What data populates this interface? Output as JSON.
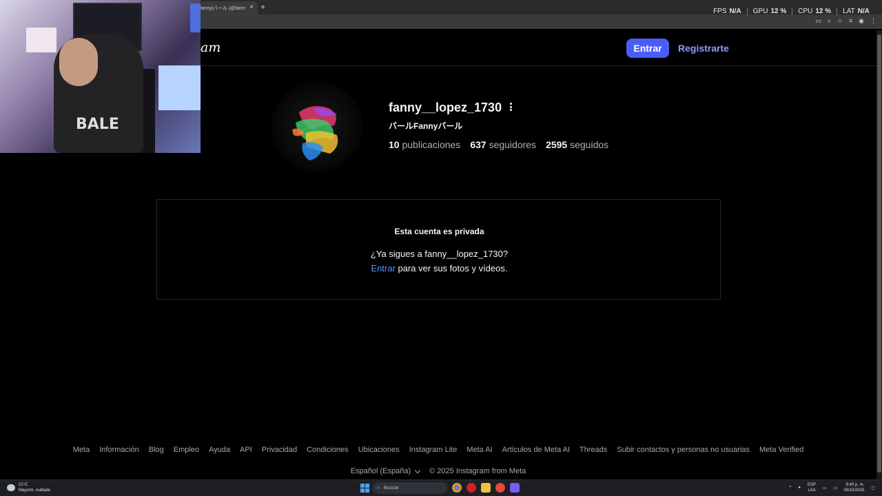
{
  "browser": {
    "tab_title": "fanny|バール (@fanny__lopez_1730)",
    "tab_close": "×",
    "new_tab": "+"
  },
  "overlay_stats": [
    {
      "label": "FPS",
      "value": "N/A"
    },
    {
      "label": "GPU",
      "value": "12 %"
    },
    {
      "label": "CPU",
      "value": "12 %"
    },
    {
      "label": "LAT",
      "value": "N/A"
    }
  ],
  "webcam": {
    "shirt_text": "BALE"
  },
  "header": {
    "logo_fragment": "am",
    "login_button": "Entrar",
    "signup_link": "Registrarte"
  },
  "profile": {
    "username": "fanny__lopez_1730",
    "full_name": "バールFannyバール",
    "posts": {
      "count": "10",
      "label": "publicaciones"
    },
    "followers": {
      "count": "637",
      "label": "seguidores"
    },
    "following": {
      "count": "2595",
      "label": "seguidos"
    }
  },
  "private": {
    "title": "Esta cuenta es privada",
    "question": "¿Ya sigues a fanny__lopez_1730?",
    "login_link": "Entrar",
    "login_suffix": " para ver sus fotos y vídeos."
  },
  "footer": {
    "links": [
      "Meta",
      "Información",
      "Blog",
      "Empleo",
      "Ayuda",
      "API",
      "Privacidad",
      "Condiciones",
      "Ubicaciones",
      "Instagram Lite",
      "Meta AI",
      "Artículos de Meta AI",
      "Threads",
      "Subir contactos y personas no usuarias",
      "Meta Verified"
    ],
    "language": "Español (España)",
    "copyright": "© 2025 Instagram from Meta"
  },
  "taskbar": {
    "weather_temp": "21°C",
    "weather_desc": "Mayorm. nublado",
    "search_placeholder": "Buscar",
    "lang_line1": "ESP",
    "lang_line2": "LAA",
    "time": "8:40 p. m.",
    "date": "26/10/2025"
  },
  "colors": {
    "accent_button": "#4a5df9",
    "link_blue": "#4a9bf5",
    "signup_link": "#8c9cff"
  }
}
